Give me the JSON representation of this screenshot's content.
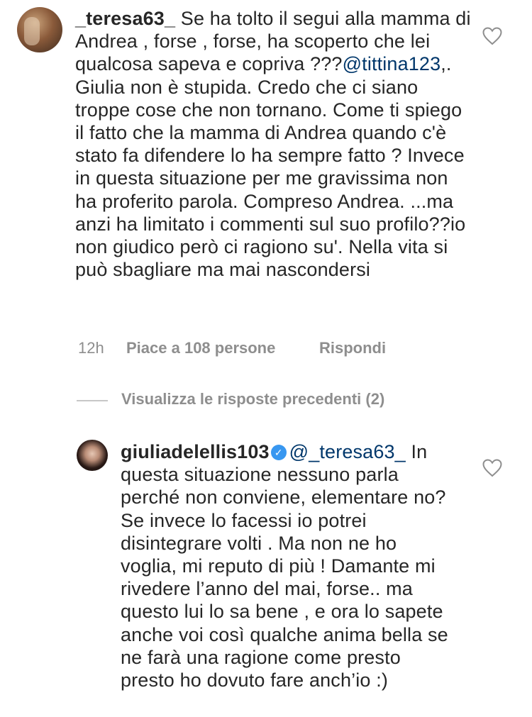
{
  "comments": [
    {
      "username": "_teresa63_",
      "text_before_mention": " Se ha tolto il segui alla mamma di Andrea , forse , forse, ha scoperto che lei qualcosa sapeva e copriva ???",
      "mention": "@tittina123",
      "text_after_mention": ",. Giulia non è stupida.  Credo che ci siano troppe cose che non tornano.  Come ti spiego il fatto che la mamma di Andrea quando c'è stato fa difendere lo ha sempre fatto ? Invece in questa situazione per me gravissima non ha proferito parola. Compreso Andrea. ...ma anzi ha limitato i commenti sul suo profilo??io non giudico però ci ragiono su'. Nella vita si può sbagliare ma  mai nascondersi",
      "time": "12h",
      "likes_label": "Piace a 108 persone",
      "reply_label": "Rispondi",
      "like_icon": "heart-outline-icon"
    },
    {
      "username": "giuliadelellis103",
      "verified_glyph": "✓",
      "mention": "@_teresa63_",
      "text_after_mention": " In questa situazione nessuno parla perché non conviene, elementare no?  Se invece lo facessi  io potrei disintegrare volti . Ma non ne ho voglia, mi reputo di più ! Damante mi rivedere l’anno del mai, forse.. ma questo lui lo sa bene , e ora lo sapete anche voi così qualche anima bella se ne farà una ragione come presto presto ho dovuto fare anch’io :)",
      "like_icon": "heart-outline-icon"
    }
  ],
  "view_replies_label": "Visualizza le risposte precedenti (2)",
  "colors": {
    "text": "#262626",
    "meta": "#8e8e8e",
    "mention": "#00376b",
    "verified": "#3897f0"
  }
}
